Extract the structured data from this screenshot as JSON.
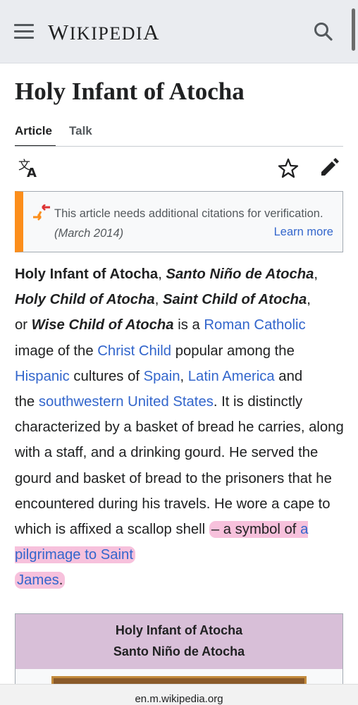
{
  "header": {
    "brand": "Wikipedia",
    "menu_icon": "hamburger-menu-icon",
    "search_icon": "search-icon"
  },
  "page": {
    "title": "Holy Infant of Atocha",
    "tabs": [
      {
        "label": "Article",
        "active": true
      },
      {
        "label": "Talk",
        "active": false
      }
    ]
  },
  "toolbar": {
    "language_icon": "translate-icon",
    "watch_icon": "star-icon",
    "edit_icon": "pencil-icon"
  },
  "notice": {
    "text": "This article needs additional citations for verification.",
    "date": "(March 2014)",
    "link": "Learn more",
    "accent_color": "#fc8e1b"
  },
  "article": {
    "t1": "Holy Infant of Atocha",
    "t2": ", ",
    "t3": "Santo Niño de Atocha",
    "t4": ",",
    "t5": "Holy Child of Atocha",
    "t6": ", ",
    "t7": "Saint Child of Atocha",
    "t8": ",",
    "t9": "or ",
    "t10": "Wise Child of Atocha",
    "t11": " is a ",
    "l1": "Roman Catholic",
    "t12": "image of the ",
    "l2": "Christ Child",
    "t13": " popular among the",
    "l3": "Hispanic",
    "t14": " cultures of ",
    "l4": "Spain",
    "t15": ", ",
    "l5": "Latin America",
    "t16": " and",
    "t17": "the ",
    "l6": "southwestern United States",
    "t18": ". It is distinctly characterized by a basket of bread he carries, along with a staff, and a drinking gourd. He served the gourd and basket of bread to the prisoners that he encountered during his travels. He wore a cape to which is affixed a scallop shell ",
    "t19": "– a symbol of ",
    "l7": "a pilgrimage to Saint",
    "l8": "James",
    "t20": ".",
    "link_color": "#3366cc",
    "highlight_color": "#f7c1dc"
  },
  "infobox": {
    "title": "Holy Infant of Atocha",
    "subtitle": "Santo Niño de Atocha",
    "header_color": "#d8bfd8"
  },
  "browser": {
    "url": "en.m.wikipedia.org"
  }
}
